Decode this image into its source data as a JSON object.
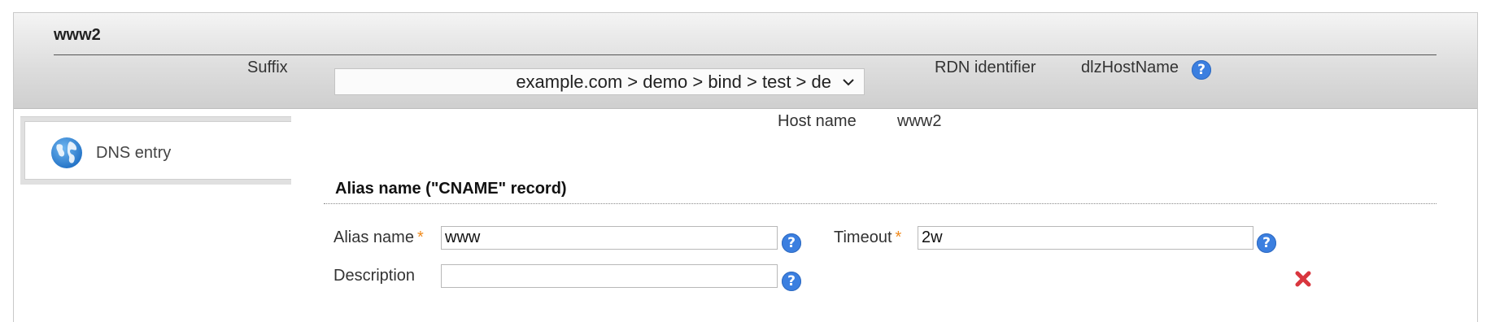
{
  "header": {
    "title": "www2",
    "suffix_label": "Suffix",
    "suffix_value": "example.com > demo > bind > test > de",
    "rdn_label": "RDN identifier",
    "rdn_value": "dlzHostName"
  },
  "tabs": [
    {
      "label": "DNS entry",
      "icon": "globe-icon"
    }
  ],
  "main": {
    "host_label": "Host name",
    "host_value": "www2",
    "section_title": "Alias name (\"CNAME\" record)",
    "alias_label": "Alias name",
    "alias_value": "www",
    "timeout_label": "Timeout",
    "timeout_value": "2w",
    "description_label": "Description",
    "description_value": "",
    "required_mark": "*",
    "help_glyph": "?"
  },
  "colors": {
    "help": "#3b7fe0",
    "required": "#f08a1c",
    "delete": "#d9363e",
    "globe": "#2f86d8"
  }
}
